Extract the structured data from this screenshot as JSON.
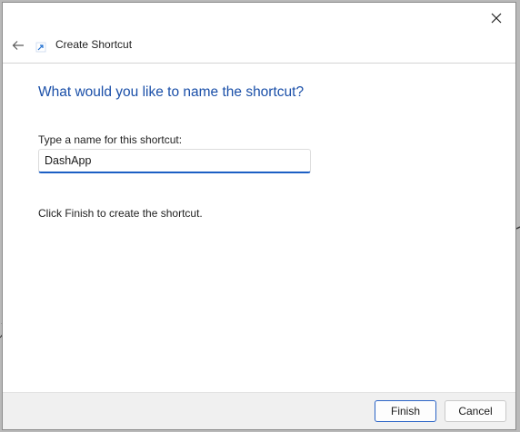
{
  "window": {
    "title": "Create Shortcut",
    "close_icon": "close-icon",
    "back_icon": "back-arrow-icon",
    "app_icon": "shortcut-icon"
  },
  "page": {
    "heading": "What would you like to name the shortcut?",
    "name_label": "Type a name for this shortcut:",
    "name_value": "DashApp",
    "info_text": "Click Finish to create the shortcut."
  },
  "footer": {
    "finish_label": "Finish",
    "cancel_label": "Cancel"
  },
  "colors": {
    "accent": "#1a4fa8",
    "input_underline": "#1c5fc4",
    "footer_bg": "#f0f0f0"
  }
}
